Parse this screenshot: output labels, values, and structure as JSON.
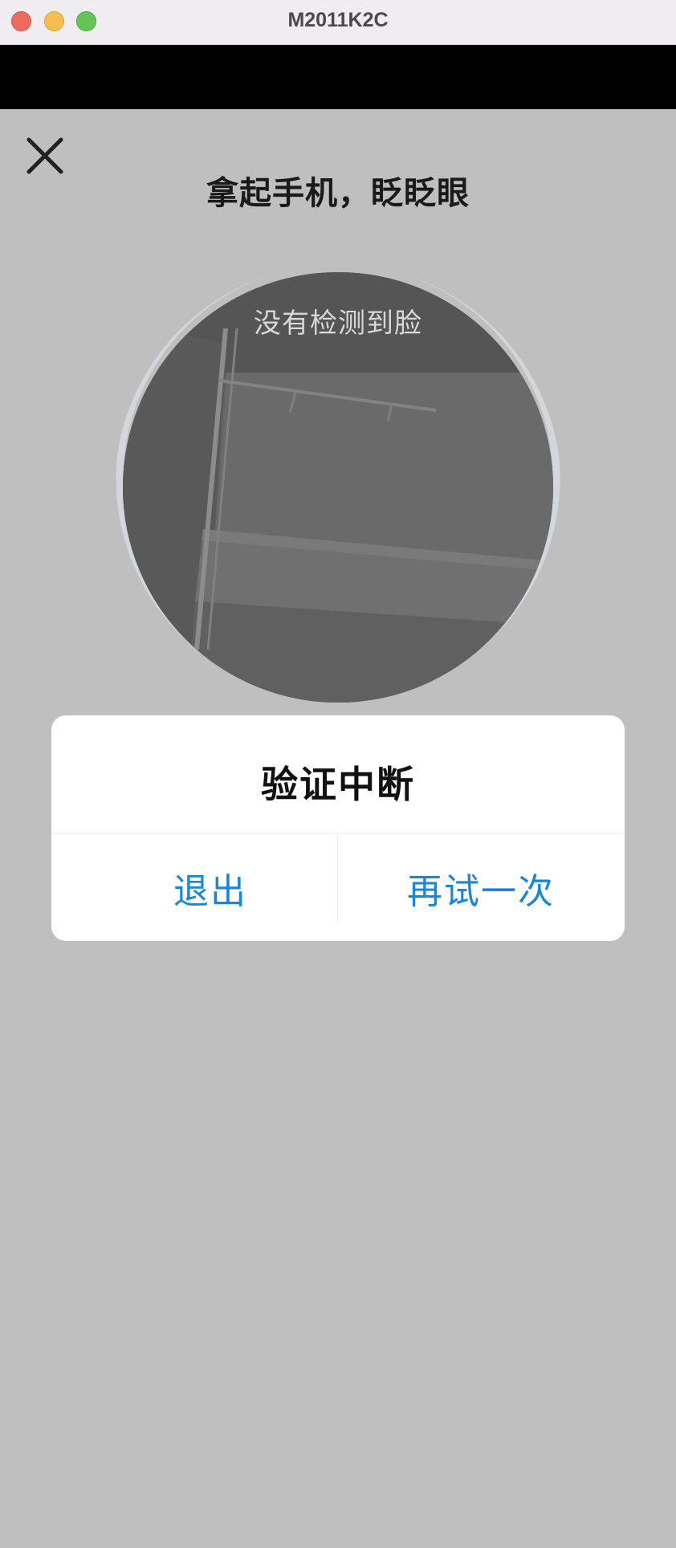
{
  "window": {
    "title": "M2011K2C"
  },
  "page": {
    "headline": "拿起手机，眨眨眼",
    "camera_hint": "没有检测到脸",
    "close_icon": "close-icon"
  },
  "dialog": {
    "title": "验证中断",
    "exit_label": "退出",
    "retry_label": "再试一次",
    "accent_color": "#1a86d8"
  }
}
